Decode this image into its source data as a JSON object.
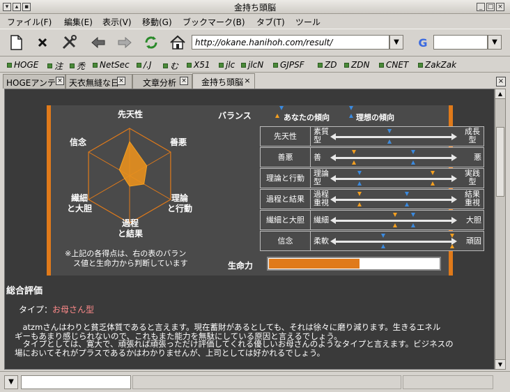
{
  "window": {
    "title": "金持ち頭脳"
  },
  "menu": [
    "ファイル(F)",
    "編集(E)",
    "表示(V)",
    "移動(G)",
    "ブックマーク(B)",
    "タブ(T)",
    "ツール"
  ],
  "url": {
    "value": "http://okane.hanihoh.com/result/"
  },
  "search": {
    "engine_icon": "G"
  },
  "bookmarks": [
    "HOGE",
    "注",
    "禿",
    "NetSec",
    "/.J",
    "む",
    "X51",
    "jlc",
    "jlcN",
    "GJPSF",
    "ZD",
    "ZDN",
    "CNET",
    "ZakZak"
  ],
  "tabs": [
    {
      "label": "HOGEアンテ"
    },
    {
      "label": "天衣無縫な日"
    },
    {
      "label": "文章分析"
    },
    {
      "label": "金持ち頭脳"
    }
  ],
  "radar": {
    "axes": [
      "先天性",
      "善悪",
      "理論と行動",
      "過程と結果",
      "繊細と大胆",
      "信念"
    ],
    "labels": {
      "a0": "先天性",
      "a1": "善悪",
      "a2a": "理論",
      "a2b": "と行動",
      "a3a": "過程",
      "a3b": "と結果",
      "a4a": "繊細",
      "a4b": "と大胆",
      "a5": "信念"
    },
    "values": [
      0.72,
      0.42,
      0.35,
      0.22,
      0.12,
      0.25
    ],
    "note1": "※上記の各得点は、右の表のバラン",
    "note2": "ス値と生命力から判断しています"
  },
  "balance": {
    "title": "バランス",
    "legend_you": "あなたの傾向",
    "legend_ideal": "理想の傾向",
    "rows": [
      {
        "name": "先天性",
        "left": "素質型",
        "right": "成長型",
        "you": 0.45,
        "ideal": 0.45
      },
      {
        "name": "善悪",
        "left": "善",
        "right": "悪",
        "you": 0.15,
        "ideal": 0.65
      },
      {
        "name": "理論と行動",
        "left": "理論型",
        "right": "実践型",
        "you": 0.82,
        "ideal": 0.2
      },
      {
        "name": "過程と結果",
        "left": "過程重視",
        "right": "結果重視",
        "you": 0.2,
        "ideal": 0.6
      },
      {
        "name": "繊細と大胆",
        "left": "繊細",
        "right": "大胆",
        "you": 0.5,
        "ideal": 0.65
      },
      {
        "name": "信念",
        "left": "柔軟",
        "right": "頑固",
        "you": 0.98,
        "ideal": 0.4
      }
    ],
    "life_label": "生命力",
    "life_value": 0.53
  },
  "evaluation": {
    "heading": "総合評価",
    "type_label": "タイプ：",
    "type_value": "お母さん型",
    "p1a": "　atzmさんはわりと貧乏体質であると言えます。現在蓄財があるとしても、それは徐々に磨り減ります。生きるエネル",
    "p1b": "ギーもあまり感じられないので、これもまた能力を無駄にしている原因と言えるでしょう。",
    "p2a": "　タイプとしては、寛大で、頑張れば頑張っただけ評価してくれる優しいお母さんのようなタイプと言えます。ビジネスの",
    "p2b": "場においてそれがプラスであるかはわかりませんが、上司としては好かれるでしょう。"
  },
  "colors": {
    "accent": "#e07a1a",
    "you": "#f5a020",
    "ideal": "#3a8ae0",
    "type": "#ff8a8a"
  }
}
